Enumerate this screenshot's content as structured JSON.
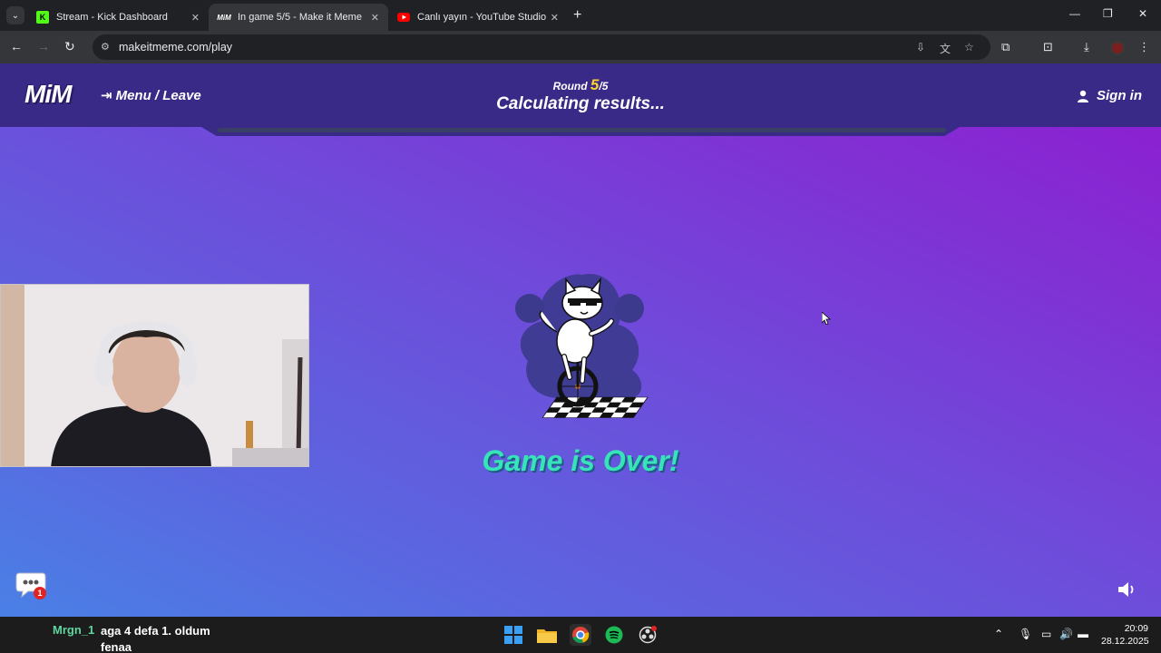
{
  "browser": {
    "tabs": [
      {
        "title": "Stream - Kick Dashboard",
        "active": false,
        "favicon": "kick-icon"
      },
      {
        "title": "In game 5/5 - Make it Meme",
        "active": true,
        "favicon": "mim-icon"
      },
      {
        "title": "Canlı yayın - YouTube Studio",
        "active": false,
        "favicon": "youtube-icon"
      }
    ],
    "url": "makeitmeme.com/play"
  },
  "game": {
    "logo": "MiM",
    "menu_label": "Menu / Leave",
    "round_label": "Round",
    "round_current": "5",
    "round_total": "/5",
    "status": "Calculating results...",
    "signin_label": "Sign in",
    "headline": "Game is Over!",
    "progress": 1.0,
    "chat_unread": "1"
  },
  "overlay": {
    "chat_user": "Mrgn_1",
    "chat_message": "aga 4 defa 1. oldum fenaa"
  },
  "taskbar": {
    "time": "20:09",
    "date": "28.12.2025"
  },
  "colors": {
    "accent_green": "#36e4b8",
    "round_yellow": "#ffd429",
    "header_bg": "#3a2a87"
  }
}
